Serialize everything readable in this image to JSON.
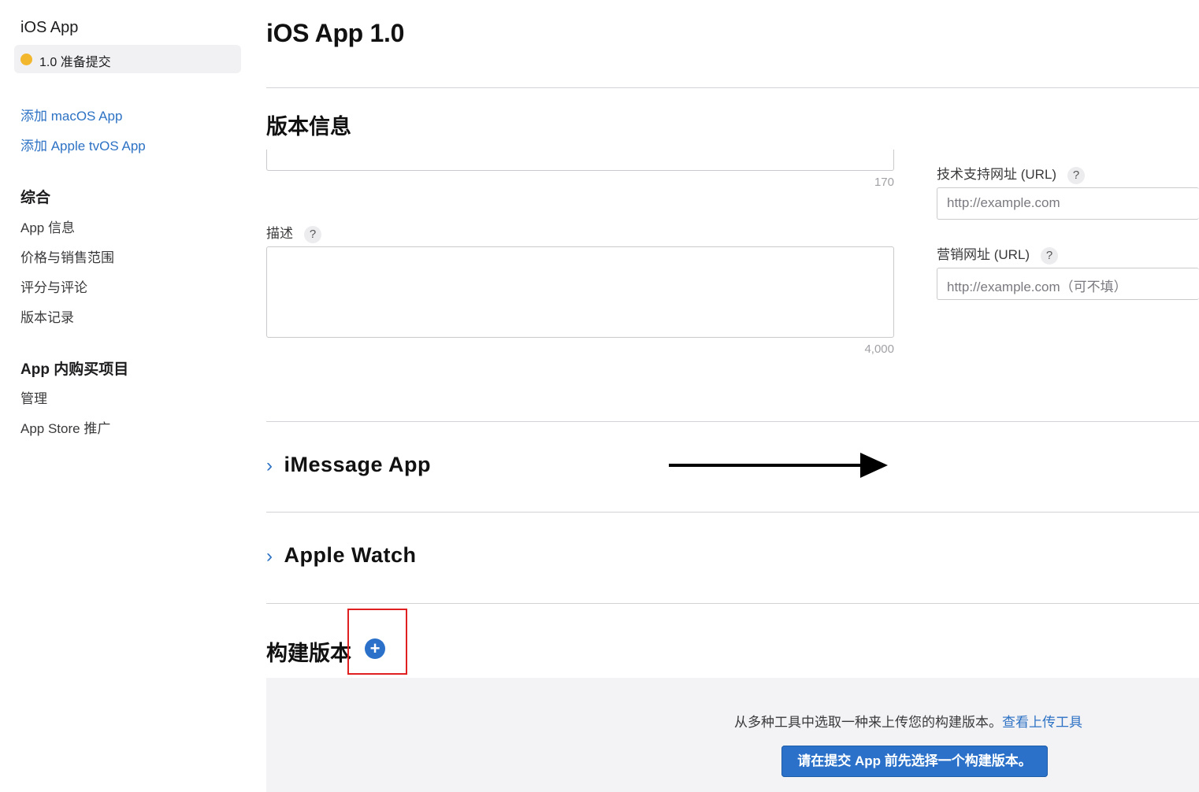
{
  "sidebar": {
    "app_title": "iOS App",
    "version_status_label": "1.0 准备提交",
    "status_color": "#f3b72d",
    "add_links": [
      "添加 macOS App",
      "添加 Apple tvOS App"
    ],
    "general_heading": "综合",
    "general_items": [
      "App 信息",
      "价格与销售范围",
      "评分与评论",
      "版本记录"
    ],
    "iap_heading": "App 内购买项目",
    "iap_items": [
      "管理",
      "App Store 推广"
    ]
  },
  "main": {
    "page_title": "iOS App 1.0",
    "version_info_title": "版本信息",
    "promo_text_counter": "170",
    "description_label": "描述",
    "description_counter": "4,000",
    "help_glyph": "?",
    "support_url_label": "技术支持网址 (URL)",
    "support_url_placeholder": "http://example.com",
    "marketing_url_label": "营销网址 (URL)",
    "marketing_url_placeholder": "http://example.com（可不填）",
    "imessage_title": "iMessage App",
    "watch_title": "Apple Watch",
    "build_title": "构建版本",
    "upload_text": "从多种工具中选取一种来上传您的构建版本。",
    "upload_link": "查看上传工具",
    "select_build_button": "请在提交 App 前先选择一个构建版本。",
    "accent_color": "#2b71c9",
    "highlight_color": "#e02020"
  }
}
